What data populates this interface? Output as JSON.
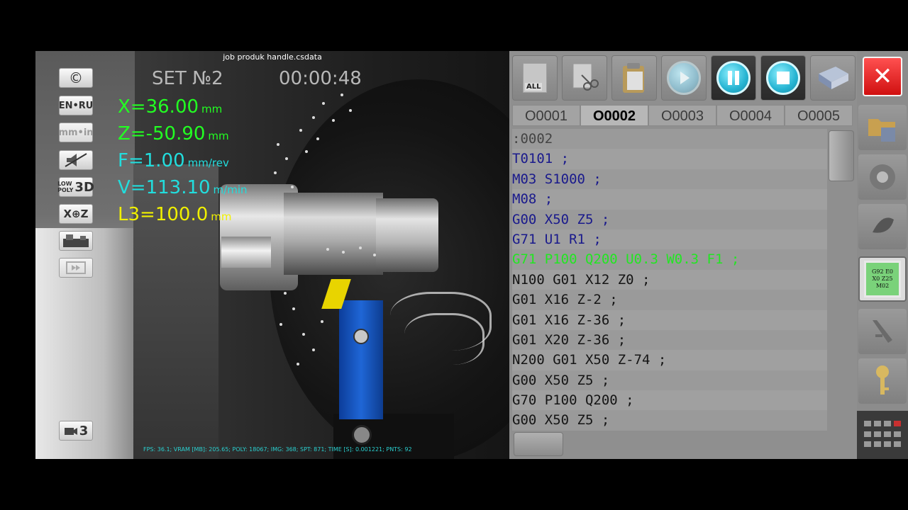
{
  "viewport": {
    "file_title": "job produk handle.csdata",
    "set_label": "SET №2",
    "timer": "00:00:48",
    "coords": [
      {
        "value": "X=36.00",
        "unit": "mm"
      },
      {
        "value": "Z=-50.90",
        "unit": "mm"
      },
      {
        "value": "F=1.00",
        "unit": "mm/rev"
      },
      {
        "value": "V=113.10",
        "unit": "m/min"
      },
      {
        "value": "L3=100.0",
        "unit": "mm"
      }
    ],
    "fps_line": "FPS: 36.1; VRAM [MB]: 205.65; POLY: 18067; IMG: 368; SPT: 871; TIME [S]: 0.001221; PNTS: 92",
    "tools": {
      "copyright": "©",
      "lang": "EN•RU",
      "units": "mm•in",
      "lowpoly_top": "LOW",
      "lowpoly_mid": "POLY",
      "lowpoly_3d": "3D",
      "axis": "X⊕Z",
      "camera": "3"
    }
  },
  "editor": {
    "toolbar": {
      "select_all": "ALL"
    },
    "tabs": [
      "O0001",
      "O0002",
      "O0003",
      "O0004",
      "O0005"
    ],
    "selected_tab": "O0002",
    "code_lines": [
      ":0002",
      "T0101 ;",
      "M03 S1000 ;",
      "M08 ;",
      "G00 X50 Z5 ;",
      "G71 U1 R1 ;",
      "G71 P100 Q200 U0.3 W0.3 F1 ;",
      "N100 G01 X12 Z0 ;",
      "G01 X16 Z-2 ;",
      "G01 X16 Z-36 ;",
      "G01 X20 Z-36 ;",
      "N200 G01 X50 Z-74 ;",
      "G00 X50 Z5 ;",
      "G70 P100 Q200 ;",
      "G00 X50 Z5 ;"
    ]
  },
  "rightbar": {
    "close": "✕",
    "cnc_screen": [
      "G92 E0",
      "X0 Z25",
      "M02"
    ]
  },
  "colors": {
    "coord_green": "#22ff22",
    "coord_cyan": "#22dddd",
    "coord_yellow": "#f0f000",
    "code_blue": "#1a1a8c",
    "code_active_green": "#22e622",
    "close_red": "#e01818"
  }
}
